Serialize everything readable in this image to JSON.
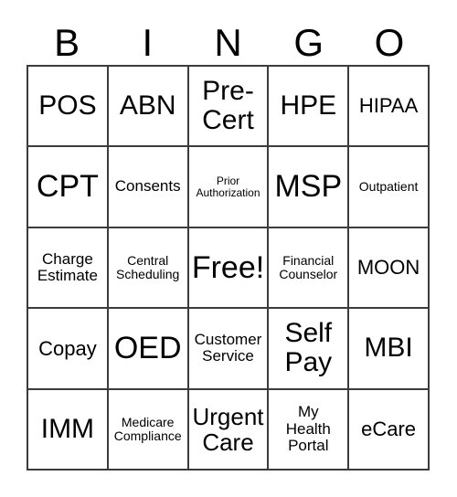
{
  "card": {
    "title_letters": [
      "B",
      "I",
      "N",
      "G",
      "O"
    ],
    "colors": {
      "background": "#ffffff",
      "border": "#3c3c3c",
      "text": "#000000"
    },
    "rows": [
      [
        {
          "label": "POS",
          "size": "xl"
        },
        {
          "label": "ABN",
          "size": "xl"
        },
        {
          "label": "Pre-\nCert",
          "size": "xl"
        },
        {
          "label": "HPE",
          "size": "xl"
        },
        {
          "label": "HIPAA",
          "size": "md"
        }
      ],
      [
        {
          "label": "CPT",
          "size": "xxl"
        },
        {
          "label": "Consents",
          "size": "sm"
        },
        {
          "label": "Prior\nAuthorization",
          "size": "xxs"
        },
        {
          "label": "MSP",
          "size": "xxl"
        },
        {
          "label": "Outpatient",
          "size": "xs"
        }
      ],
      [
        {
          "label": "Charge\nEstimate",
          "size": "sm"
        },
        {
          "label": "Central\nScheduling",
          "size": "xs"
        },
        {
          "label": "Free!",
          "size": "xxl"
        },
        {
          "label": "Financial\nCounselor",
          "size": "xs"
        },
        {
          "label": "MOON",
          "size": "md"
        }
      ],
      [
        {
          "label": "Copay",
          "size": "md"
        },
        {
          "label": "OED",
          "size": "xxl"
        },
        {
          "label": "Customer\nService",
          "size": "sm"
        },
        {
          "label": "Self\nPay",
          "size": "xl"
        },
        {
          "label": "MBI",
          "size": "xl"
        }
      ],
      [
        {
          "label": "IMM",
          "size": "xl"
        },
        {
          "label": "Medicare\nCompliance",
          "size": "xs"
        },
        {
          "label": "Urgent\nCare",
          "size": "lg"
        },
        {
          "label": "My\nHealth\nPortal",
          "size": "sm"
        },
        {
          "label": "eCare",
          "size": "md"
        }
      ]
    ]
  }
}
